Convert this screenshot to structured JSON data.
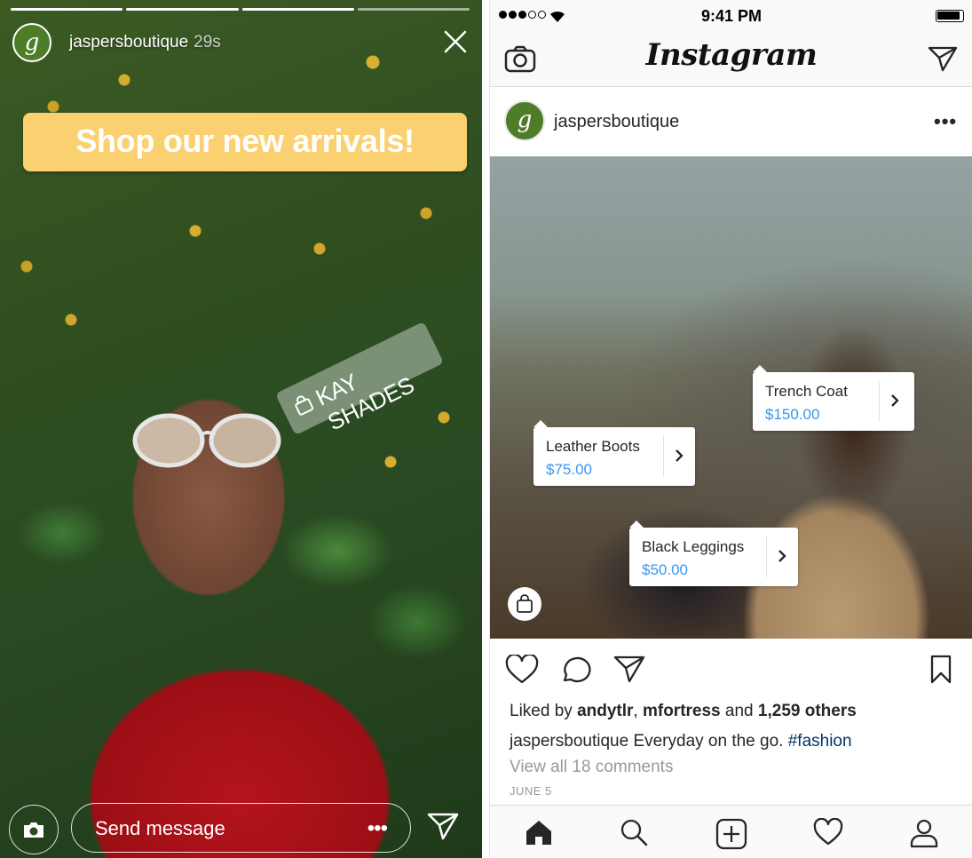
{
  "story": {
    "username": "jaspersboutique",
    "avatar_letter": "g",
    "time_ago": "29s",
    "progress_segments": [
      1,
      1,
      1,
      0.0
    ],
    "banner_text": "Shop our new arrivals!",
    "product_sticker": "KAY SHADES",
    "message_placeholder": "Send message",
    "more_label": "•••",
    "colors": {
      "banner": "#fbd071"
    }
  },
  "feed": {
    "status": {
      "time": "9:41 PM",
      "signal_bars_filled": 3,
      "signal_bars_total": 5
    },
    "nav": {
      "logo": "Instagram"
    },
    "post": {
      "username": "jaspersboutique",
      "avatar_letter": "g",
      "more_label": "•••",
      "tags": [
        {
          "name": "Trench Coat",
          "price": "$150.00"
        },
        {
          "name": "Leather Boots",
          "price": "$75.00"
        },
        {
          "name": "Black Leggings",
          "price": "$50.00"
        }
      ],
      "likes": {
        "prefix": "Liked by",
        "user1": "andytlr",
        "sep": ",",
        "user2": "mfortress",
        "and": "and",
        "count": "1,259 others"
      },
      "caption": {
        "user": "jaspersboutique",
        "text": "Everyday on the go.",
        "hashtag": "#fashion"
      },
      "comments_link": "View all 18 comments",
      "date": "JUNE 5"
    },
    "colors": {
      "price": "#3897f0",
      "hashtag": "#003569"
    }
  },
  "icons": [
    "close-icon",
    "camera-icon",
    "direct-message-icon",
    "shopping-bag-icon",
    "heart-icon",
    "comment-icon",
    "bookmark-icon",
    "home-icon",
    "search-icon",
    "add-icon",
    "profile-icon",
    "chevron-right-icon",
    "wifi-icon",
    "battery-icon"
  ]
}
